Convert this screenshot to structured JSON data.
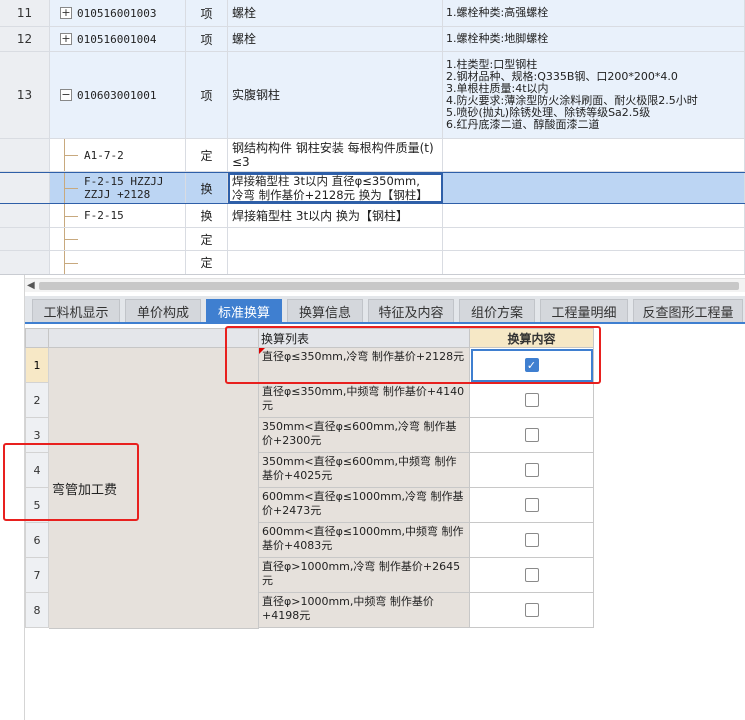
{
  "top_grid": {
    "rows": [
      {
        "num": "11",
        "code": "010516001003",
        "expander": "+",
        "type": "项",
        "name": "螺栓",
        "features": [
          "1.螺栓种类:高强螺栓"
        ]
      },
      {
        "num": "12",
        "code": "010516001004",
        "expander": "+",
        "type": "项",
        "name": "螺栓",
        "features": [
          "1.螺栓种类:地脚螺栓"
        ]
      },
      {
        "num": "13",
        "code": "010603001001",
        "expander": "−",
        "type": "项",
        "name": "实腹钢柱",
        "features": [
          "1.柱类型:口型钢柱",
          "2.钢材品种、规格:Q335B钢、口200*200*4.0",
          "3.单根柱质量:4t以内",
          "4.防火要求:薄涂型防火涂料刷面、耐火极限2.5小时",
          "5.喷砂(抛丸)除锈处理、除锈等级Sa2.5级",
          "6.红丹底漆二道、醇酸面漆二道"
        ]
      },
      {
        "num": "",
        "code": "A1-7-2",
        "type": "定",
        "name": "钢结构构件 钢柱安装 每根构件质量(t) ≤3",
        "features": []
      },
      {
        "num": "",
        "code_lines": [
          "F-2-15 HZZJJ",
          "ZZJJ +2128"
        ],
        "type": "换",
        "name_lines": [
          "焊接箱型柱 3t以内  直径φ≤350mm,",
          "冷弯 制作基价+2128元  换为【钢柱】"
        ],
        "features": []
      },
      {
        "num": "",
        "code": "F-2-15",
        "type": "换",
        "name": "焊接箱型柱 3t以内  换为【钢柱】",
        "features": []
      },
      {
        "num": "",
        "code": "",
        "type": "定",
        "name": "",
        "features": []
      },
      {
        "num": "",
        "code": "",
        "type": "定",
        "name": "",
        "features": []
      }
    ]
  },
  "tabs": [
    {
      "label": "工料机显示"
    },
    {
      "label": "单价构成"
    },
    {
      "label": "标准换算",
      "active": true
    },
    {
      "label": "换算信息"
    },
    {
      "label": "特征及内容"
    },
    {
      "label": "组价方案"
    },
    {
      "label": "工程量明细"
    },
    {
      "label": "反查图形工程量"
    }
  ],
  "lower": {
    "header_list": "换算列表",
    "header_content": "换算内容",
    "group_label": "弯管加工费",
    "rows": [
      {
        "num": "1",
        "text": "直径φ≤350mm,冷弯 制作基价+2128元",
        "checked": true
      },
      {
        "num": "2",
        "text": "直径φ≤350mm,中频弯 制作基价+4140元",
        "checked": false
      },
      {
        "num": "3",
        "text": "350mm<直径φ≤600mm,冷弯 制作基价+2300元",
        "checked": false
      },
      {
        "num": "4",
        "text": "350mm<直径φ≤600mm,中频弯 制作基价+4025元",
        "checked": false
      },
      {
        "num": "5",
        "text": "600mm<直径φ≤1000mm,冷弯 制作基价+2473元",
        "checked": false
      },
      {
        "num": "6",
        "text": "600mm<直径φ≤1000mm,中频弯 制作基价+4083元",
        "checked": false
      },
      {
        "num": "7",
        "text": "直径φ>1000mm,冷弯 制作基价+2645元",
        "checked": false
      },
      {
        "num": "8",
        "text": "直径φ>1000mm,中频弯 制作基价+4198元",
        "checked": false
      }
    ]
  },
  "colors": {
    "accent": "#3f7fd0",
    "annotation": "#e8201e",
    "header_highlight": "#f6e8c6"
  }
}
